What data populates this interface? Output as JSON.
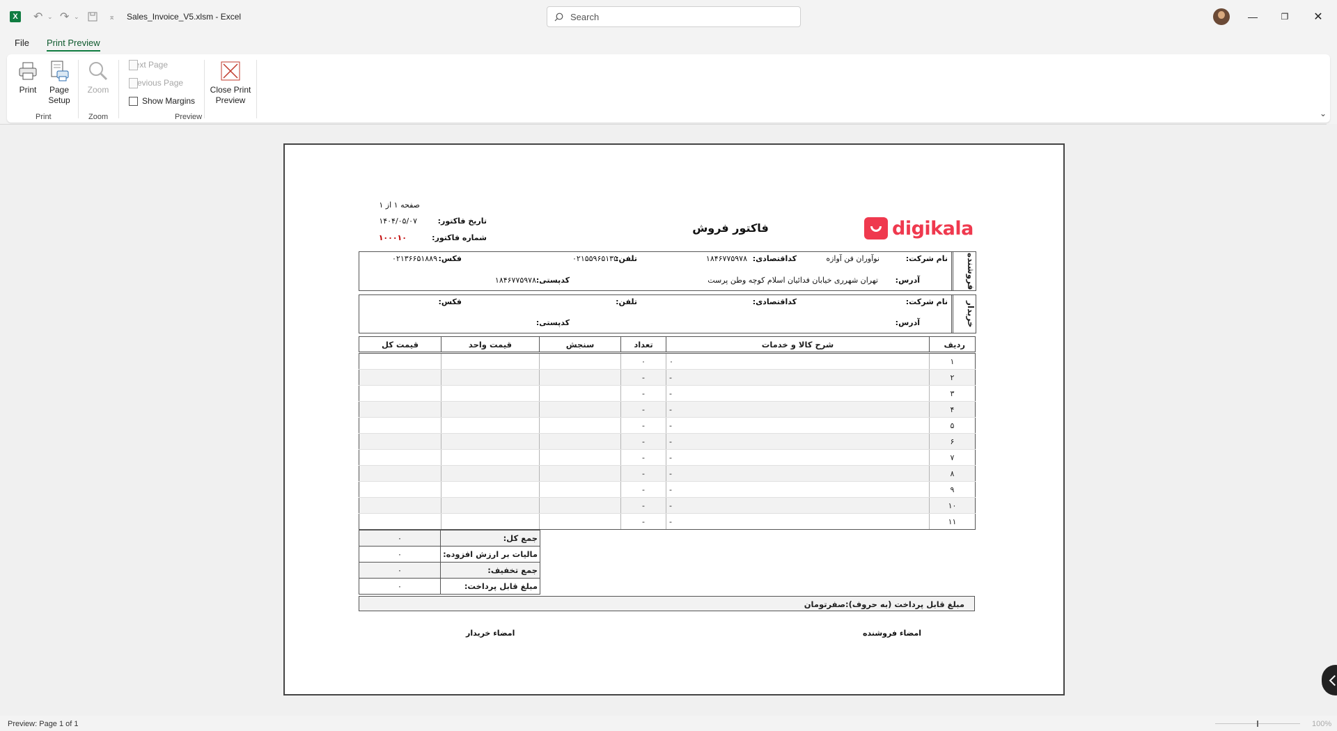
{
  "window": {
    "doc_title": "Sales_Invoice_V5.xlsm  -  Excel",
    "search_placeholder": "Search",
    "logo_letter": "X"
  },
  "tabs": {
    "file": "File",
    "print_preview": "Print Preview"
  },
  "ribbon": {
    "print": "Print",
    "page_setup_1": "Page",
    "page_setup_2": "Setup",
    "zoom": "Zoom",
    "next_page": "Next Page",
    "previous_page": "Previous Page",
    "show_margins": "Show Margins",
    "close_1": "Close Print",
    "close_2": "Preview",
    "group_print": "Print",
    "group_zoom": "Zoom",
    "group_preview": "Preview"
  },
  "invoice": {
    "brand": "digikala",
    "title": "فاکتور فروش",
    "page_info": "صفحه ۱ از ۱",
    "date_label": "تاریخ فاکتور:",
    "date_value": "۱۴۰۴/۰۵/۰۷",
    "number_label": "شماره فاکتور:",
    "number_value": "۱۰۰۰۱۰",
    "seller": {
      "side_label": "فروشنده",
      "company_label": "نام شرکت:",
      "company_value": "نوآوران فن آوازه",
      "econ_label": "کداقتصادی:",
      "econ_value": "۱۸۴۶۷۷۵۹۷۸",
      "phone_label": "تلفن:",
      "phone_value": "۰۲۱۵۵۹۶۵۱۳۵",
      "fax_label": "فکس:",
      "fax_value": "۰۲۱۳۶۶۵۱۸۸۹",
      "address_label": "آدرس:",
      "address_value": "تهران شهرری خیابان فدائیان اسلام کوچه وطن پرست",
      "postal_label": "کدپستی:",
      "postal_value": "۱۸۴۶۷۷۵۹۷۸"
    },
    "buyer": {
      "side_label": "خریدار",
      "company_label": "نام شرکت:",
      "econ_label": "کداقتصادی:",
      "phone_label": "تلفن:",
      "fax_label": "فکس:",
      "address_label": "آدرس:",
      "postal_label": "کدپستی:"
    },
    "columns": [
      "ردیف",
      "شرح کالا و خدمات",
      "تعداد",
      "سنجش",
      "قیمت واحد",
      "قیمت کل"
    ],
    "rows": [
      {
        "n": "۱",
        "desc": "۰",
        "qty": "۰"
      },
      {
        "n": "۲",
        "desc": "-",
        "qty": "-"
      },
      {
        "n": "۳",
        "desc": "-",
        "qty": "-"
      },
      {
        "n": "۴",
        "desc": "-",
        "qty": "-"
      },
      {
        "n": "۵",
        "desc": "-",
        "qty": "-"
      },
      {
        "n": "۶",
        "desc": "-",
        "qty": "-"
      },
      {
        "n": "۷",
        "desc": "-",
        "qty": "-"
      },
      {
        "n": "۸",
        "desc": "-",
        "qty": "-"
      },
      {
        "n": "۹",
        "desc": "-",
        "qty": "-"
      },
      {
        "n": "۱۰",
        "desc": "-",
        "qty": "-"
      },
      {
        "n": "۱۱",
        "desc": "-",
        "qty": "-"
      }
    ],
    "totals": [
      {
        "label": "جمع کل:",
        "value": "۰"
      },
      {
        "label": "مالیات بر ارزش افزوده:",
        "value": "۰"
      },
      {
        "label": "جمع تخفیف:",
        "value": "۰"
      },
      {
        "label": "مبلغ قابل پرداخت:",
        "value": "۰"
      }
    ],
    "amount_words": "مبلغ قابل پرداخت (به حروف):صفرتومان",
    "seller_sign": "امضاء فروشنده",
    "buyer_sign": "امضاء خریدار"
  },
  "status": {
    "text": "Preview: Page 1 of 1",
    "zoom": "100%"
  },
  "colors": {
    "excel_green": "#107c41",
    "brand_red": "#ef394e",
    "invoice_number_red": "#c00000"
  }
}
